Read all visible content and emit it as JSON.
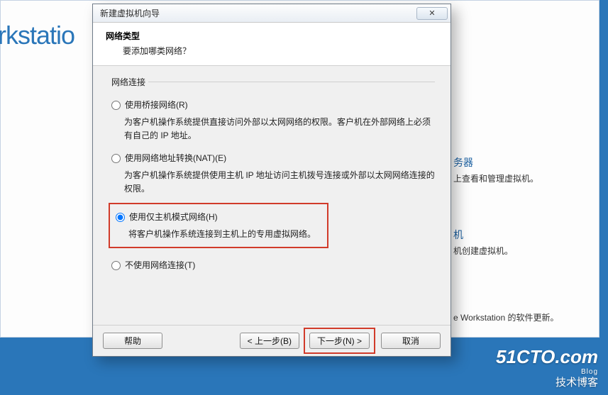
{
  "background": {
    "brand_partial": "rkstatio",
    "sidebar": {
      "item1_title_partial": "务器",
      "item1_desc_partial": "上查看和管理虚拟机。",
      "item2_title_partial": "机",
      "item2_desc_partial": "机创建虚拟机。",
      "item3_desc_partial": "e Workstation 的软件更新。"
    },
    "watermark": {
      "line1": "51CTO.com",
      "line2": "Blog",
      "line3": "技术博客"
    }
  },
  "dialog": {
    "title": "新建虚拟机向导",
    "close_glyph": "✕",
    "header": {
      "title": "网络类型",
      "subtitle": "要添加哪类网络？"
    },
    "group_label": "网络连接",
    "options": [
      {
        "label": "使用桥接网络(R)",
        "desc": "为客户机操作系统提供直接访问外部以太网网络的权限。客户机在外部网络上必须有自己的 IP 地址。"
      },
      {
        "label": "使用网络地址转换(NAT)(E)",
        "desc": "为客户机操作系统提供使用主机 IP 地址访问主机拨号连接或外部以太网网络连接的权限。"
      },
      {
        "label": "使用仅主机模式网络(H)",
        "desc": "将客户机操作系统连接到主机上的专用虚拟网络。"
      },
      {
        "label": "不使用网络连接(T)",
        "desc": ""
      }
    ],
    "selected_index": 2,
    "buttons": {
      "help": "帮助",
      "back": "< 上一步(B)",
      "next": "下一步(N) >",
      "cancel": "取消"
    }
  }
}
